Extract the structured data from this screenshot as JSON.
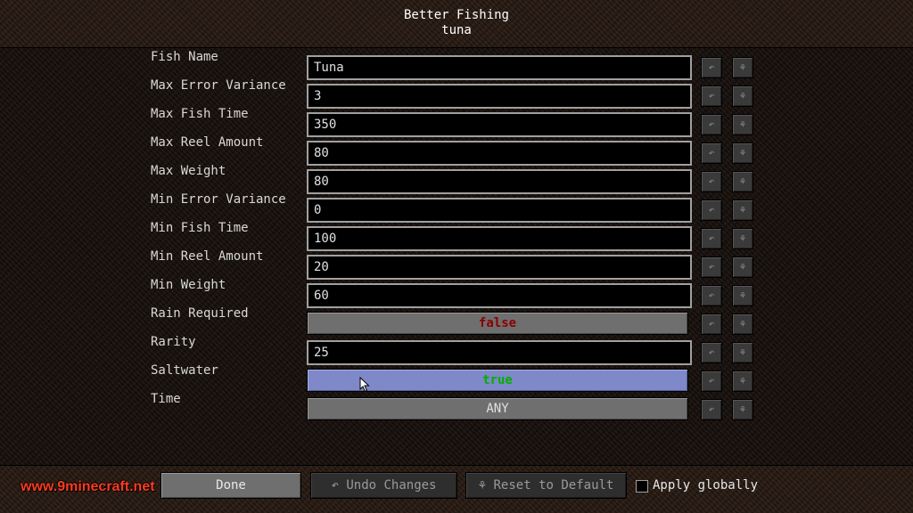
{
  "header": {
    "title": "Better Fishing",
    "subtitle": "tuna"
  },
  "rows": [
    {
      "label": "Fish Name",
      "type": "text",
      "value": "Tuna"
    },
    {
      "label": "Max Error Variance",
      "type": "text",
      "value": "3"
    },
    {
      "label": "Max Fish Time",
      "type": "text",
      "value": "350"
    },
    {
      "label": "Max Reel Amount",
      "type": "text",
      "value": "80"
    },
    {
      "label": "Max Weight",
      "type": "text",
      "value": "80"
    },
    {
      "label": "Min Error Variance",
      "type": "text",
      "value": "0"
    },
    {
      "label": "Min Fish Time",
      "type": "text",
      "value": "100"
    },
    {
      "label": "Min Reel Amount",
      "type": "text",
      "value": "20"
    },
    {
      "label": "Min Weight",
      "type": "text",
      "value": "60"
    },
    {
      "label": "Rain Required",
      "type": "toggle",
      "value": "false"
    },
    {
      "label": "Rarity",
      "type": "text",
      "value": "25"
    },
    {
      "label": "Saltwater",
      "type": "toggle",
      "value": "true"
    },
    {
      "label": "Time",
      "type": "cycle",
      "value": "ANY"
    }
  ],
  "row_icons": {
    "undo": "↶",
    "reset": "⚘"
  },
  "footer": {
    "done_label": "Done",
    "undo_label": "↶ Undo Changes",
    "reset_label": "⚘ Reset to Default",
    "apply_globally_label": "Apply globally"
  },
  "watermark": "www.9minecraft.net",
  "colors": {
    "false": "#8b0000",
    "true": "#00b000",
    "hover": "#7f88c8",
    "watermark": "#ff3b1f"
  }
}
